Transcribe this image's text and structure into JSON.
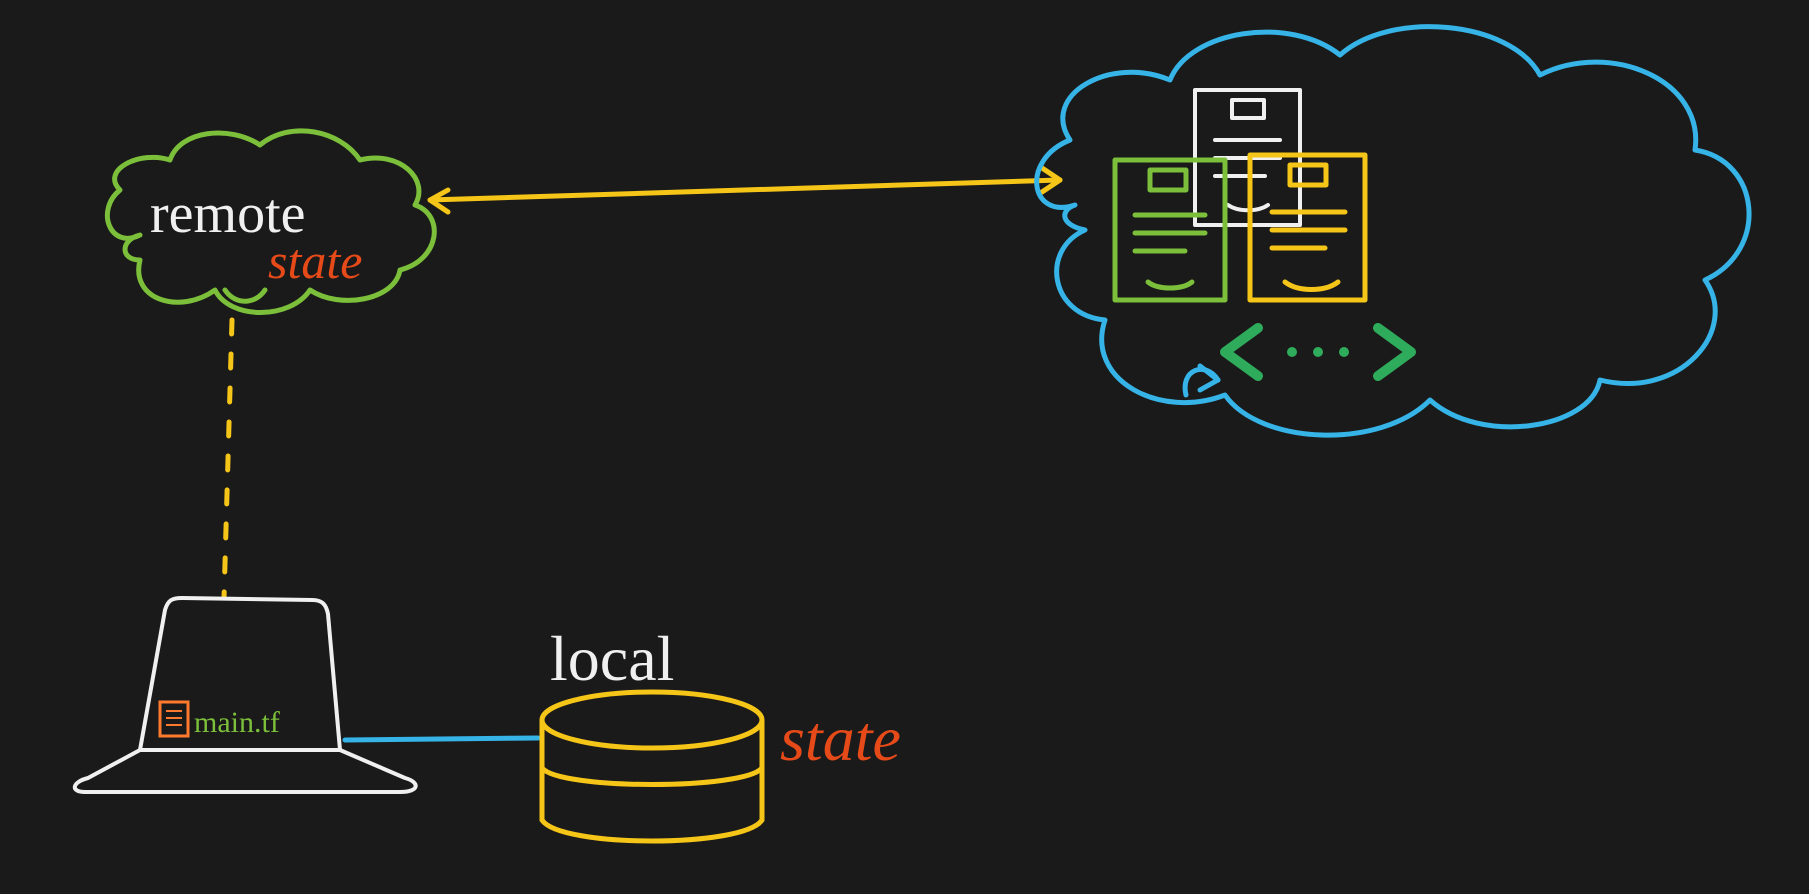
{
  "diagram": {
    "remote_cloud": {
      "label": "remote",
      "sublabel": "state"
    },
    "local_db": {
      "label": "local",
      "sublabel": "state"
    },
    "laptop": {
      "file_label": "main.tf"
    },
    "code_symbol": "<...>"
  }
}
